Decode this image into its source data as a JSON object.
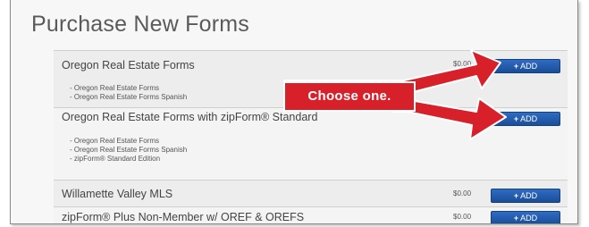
{
  "page": {
    "title": "Purchase New Forms"
  },
  "forms": [
    {
      "name": "Oregon Real Estate Forms",
      "price": "$0.00",
      "includes": [
        "- Oregon Real Estate Forms",
        "- Oregon Real Estate Forms Spanish"
      ],
      "add_label": "ADD"
    },
    {
      "name": "Oregon Real Estate Forms with zipForm® Standard",
      "price": "",
      "includes": [
        "- Oregon Real Estate Forms",
        "- Oregon Real Estate Forms Spanish",
        "- zipForm® Standard Edition"
      ],
      "add_label": "ADD"
    },
    {
      "name": "Willamette Valley MLS",
      "price": "$0.00",
      "includes": [],
      "add_label": "ADD"
    },
    {
      "name": "zipForm® Plus Non-Member w/ OREF & OREFS",
      "price": "$0.00",
      "includes": [],
      "add_label": "ADD"
    }
  ],
  "annotation": {
    "text": "Choose one.",
    "color": "#d7202a"
  },
  "colors": {
    "button": "#1f55a6",
    "frame_border": "#8a8a8a",
    "title": "#5a5a5a"
  },
  "icons": {
    "add": "plus-icon"
  }
}
